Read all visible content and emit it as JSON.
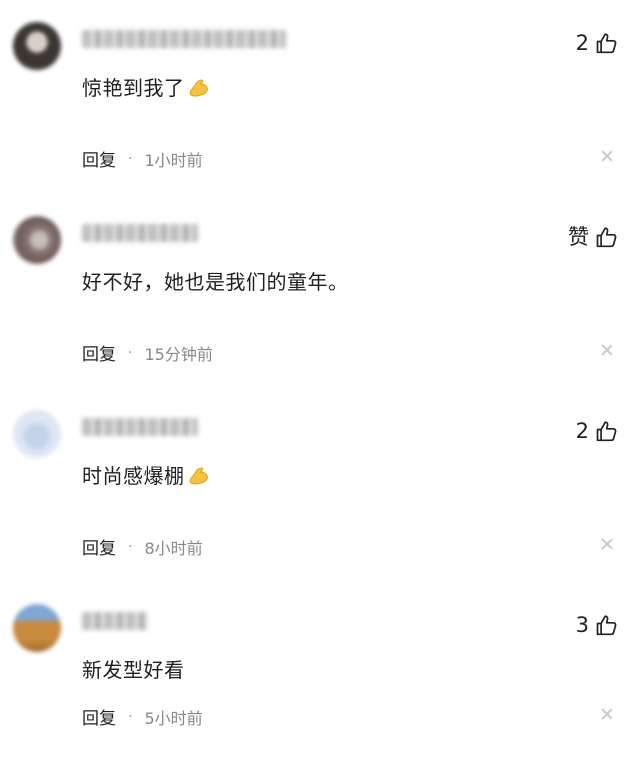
{
  "comments": [
    {
      "like_label": "2",
      "content": "惊艳到我了",
      "content_emoji": "flexed-biceps",
      "reply_label": "回复",
      "separator": "·",
      "time": "1小时前",
      "avatar_colors": [
        "#3b3631",
        "#d9cfc8"
      ]
    },
    {
      "like_label": "赞",
      "content": "好不好，她也是我们的童年。",
      "content_emoji": "",
      "reply_label": "回复",
      "separator": "·",
      "time": "15分钟前",
      "avatar_colors": [
        "#6c5a55",
        "#c8bdb6"
      ]
    },
    {
      "like_label": "2",
      "content": "时尚感爆棚",
      "content_emoji": "flexed-biceps",
      "reply_label": "回复",
      "separator": "·",
      "time": "8小时前",
      "avatar_colors": [
        "#dfe7f4",
        "#c4d2ea"
      ]
    },
    {
      "like_label": "3",
      "content": "新发型好看",
      "content_emoji": "",
      "reply_label": "回复",
      "separator": "·",
      "time": "5小时前",
      "avatar_colors": [
        "#c98a3c",
        "#7fa6d6"
      ]
    }
  ],
  "colors": {
    "text": "#1f1f1f",
    "meta": "#888888",
    "emoji": "#f5c33b"
  }
}
